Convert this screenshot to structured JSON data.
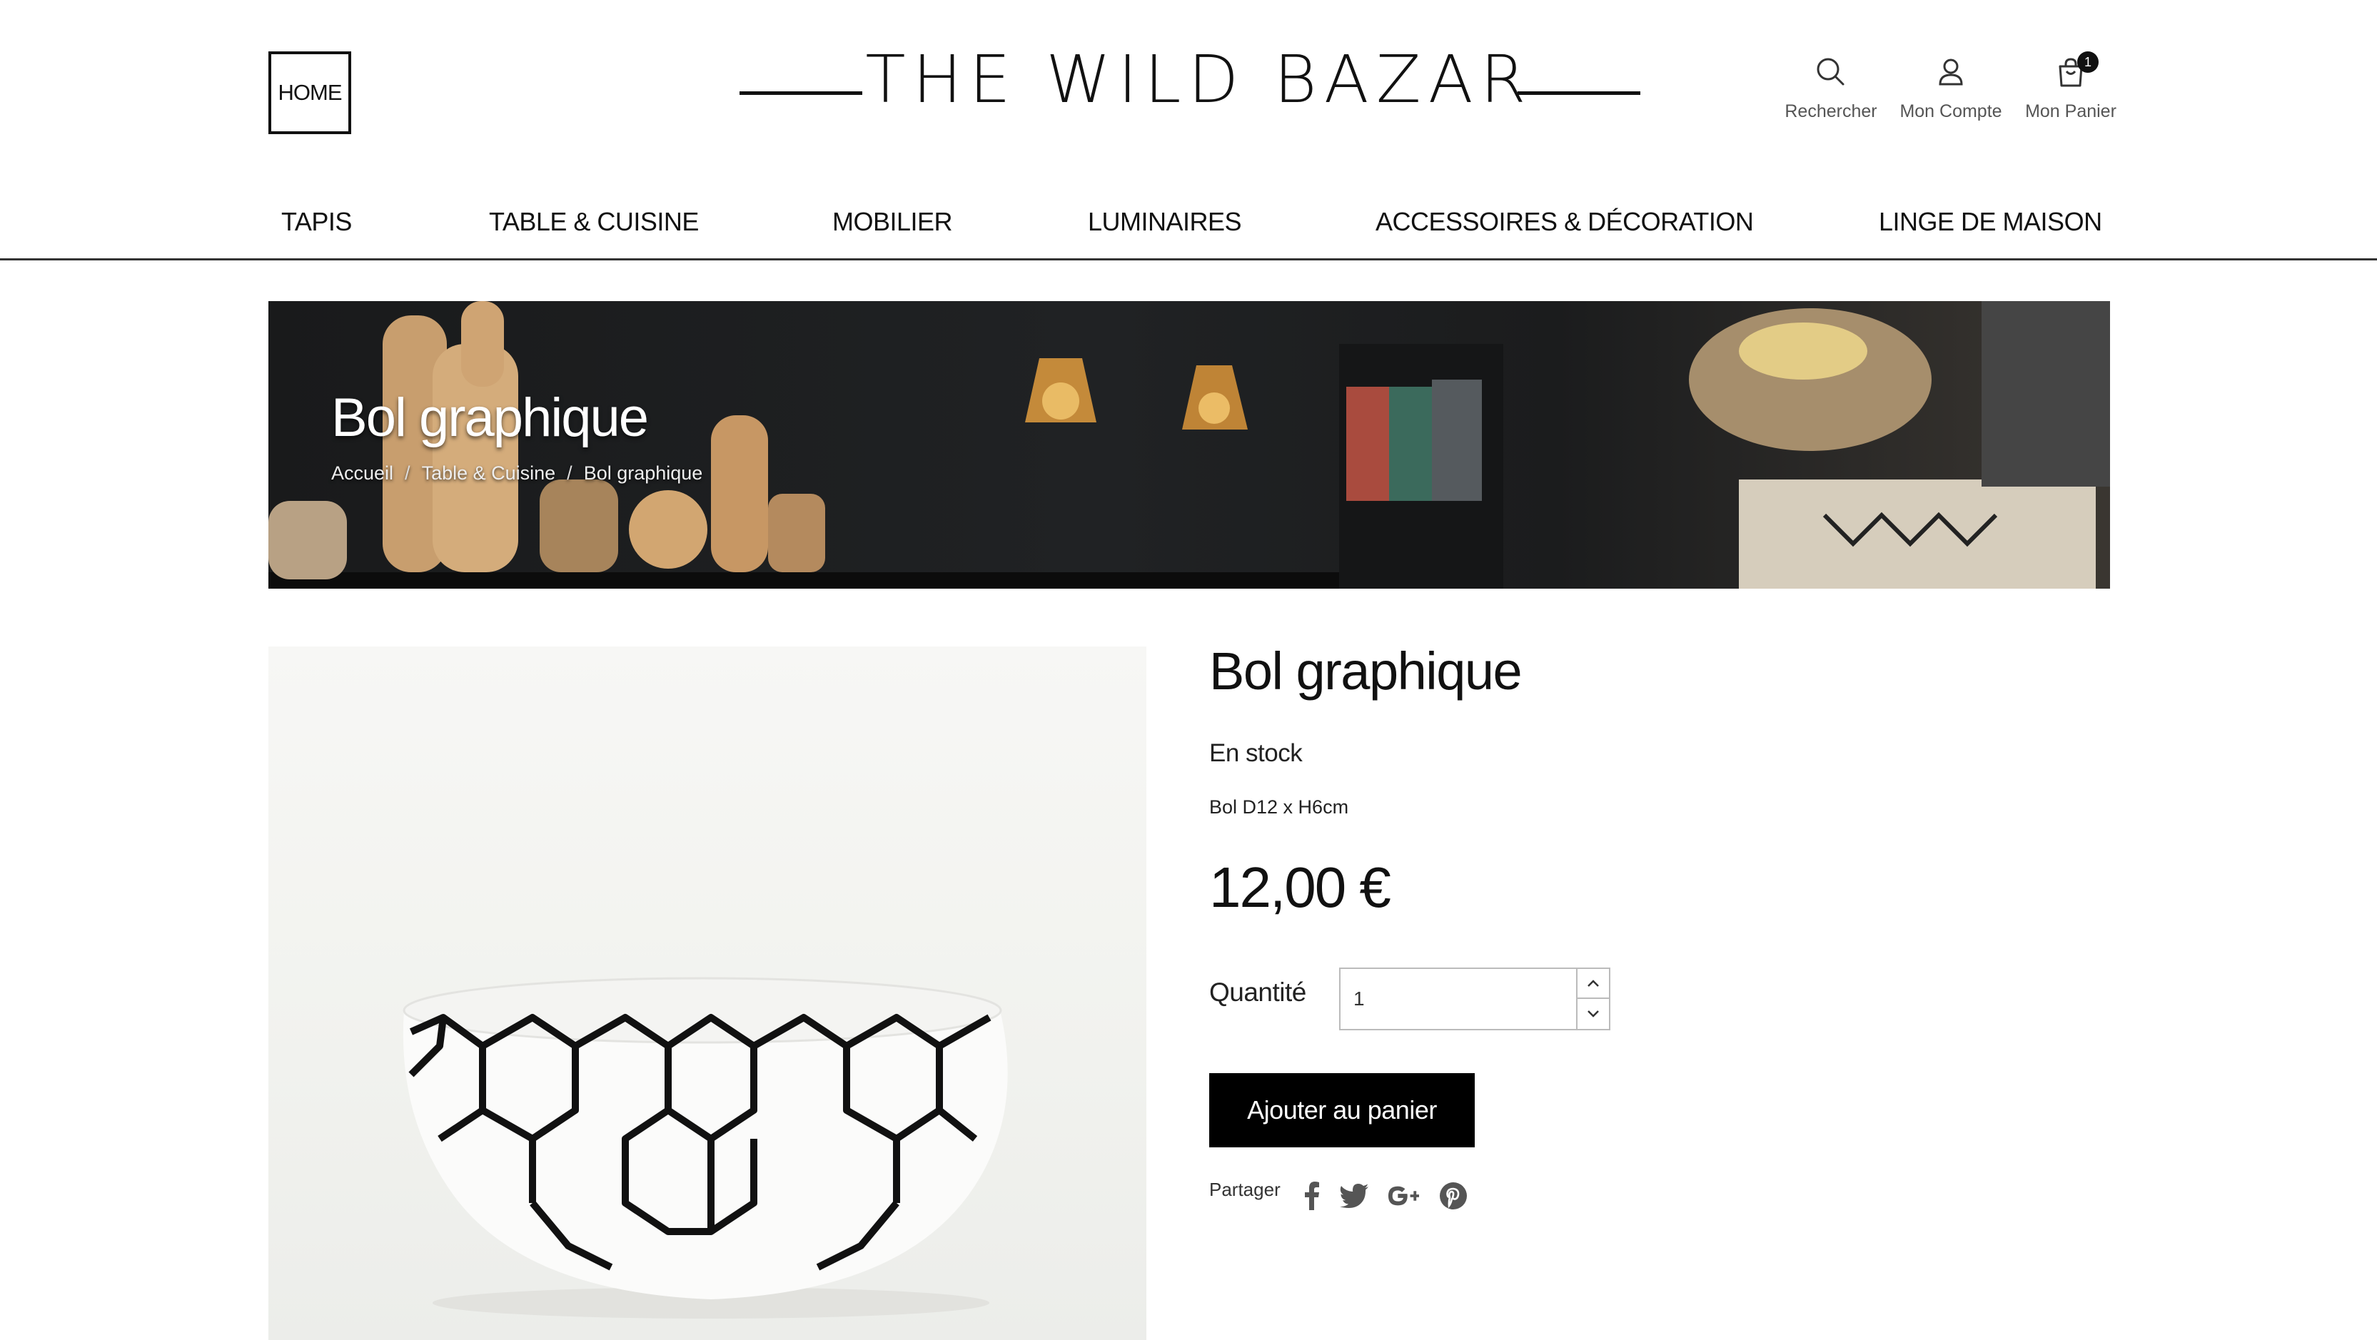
{
  "header": {
    "logo_text": "HOME",
    "brand": "THE WILD BAZAR",
    "tools": {
      "search_label": "Rechercher",
      "account_label": "Mon Compte",
      "cart_label": "Mon Panier",
      "cart_count": "1"
    }
  },
  "nav": {
    "items": [
      {
        "label": "TAPIS"
      },
      {
        "label": "TABLE & CUISINE"
      },
      {
        "label": "MOBILIER"
      },
      {
        "label": "LUMINAIRES"
      },
      {
        "label": "ACCESSOIRES & DÉCORATION"
      },
      {
        "label": "LINGE DE MAISON"
      }
    ]
  },
  "hero": {
    "title": "Bol graphique",
    "breadcrumb": [
      "Accueil",
      "Table & Cuisine",
      "Bol graphique"
    ],
    "separator": "/"
  },
  "product": {
    "title": "Bol graphique",
    "stock": "En stock",
    "description": "Bol D12 x H6cm",
    "price": "12,00 €",
    "quantity_label": "Quantité",
    "quantity_value": "1",
    "add_to_cart": "Ajouter au panier",
    "share_label": "Partager",
    "share_icons": [
      "facebook-icon",
      "twitter-icon",
      "google-plus-icon",
      "pinterest-icon"
    ]
  },
  "colors": {
    "text": "#111111",
    "button_bg": "#000000",
    "button_text": "#ffffff",
    "border": "#bbbbbb"
  }
}
